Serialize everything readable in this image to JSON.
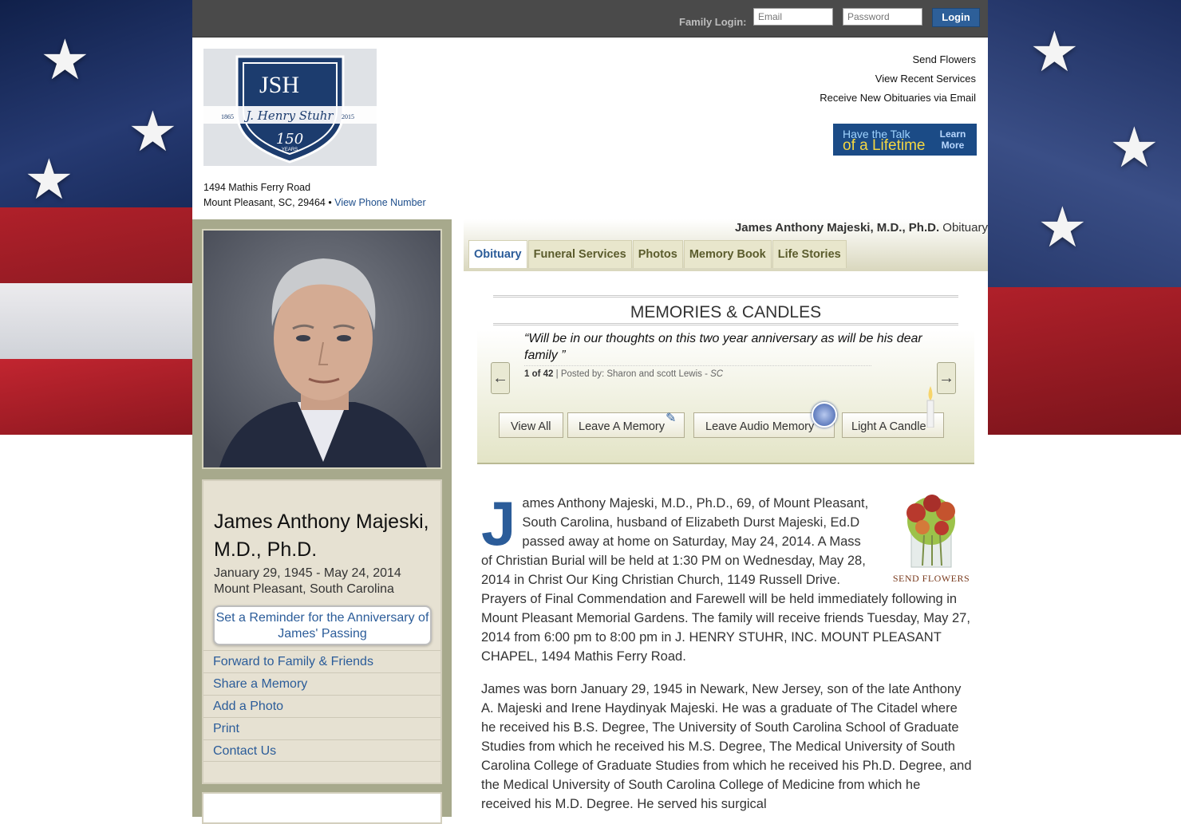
{
  "topbar": {
    "login_label": "Family Login:",
    "email_placeholder": "Email",
    "password_placeholder": "Password",
    "login_button": "Login"
  },
  "header": {
    "address_line1": "1494 Mathis Ferry Road",
    "address_line2": "Mount Pleasant, SC, 29464 •",
    "phone_link": "View Phone Number",
    "links": [
      "Send Flowers",
      "View Recent Services",
      "Receive New Obituaries via Email"
    ],
    "banner": {
      "line1": "Have the Talk",
      "line2": "of a Lifetime",
      "cta": "Learn More"
    }
  },
  "logo": {
    "letters": "JSH",
    "years_left": "1865",
    "years_right": "2015",
    "anniversary": "150",
    "anniversary_sub": "YEARS"
  },
  "deceased": {
    "name": "James Anthony Majeski, M.D., Ph.D.",
    "dates": "January 29, 1945 - May 24, 2014",
    "location": "Mount Pleasant, South Carolina",
    "reminder": "Set a Reminder for the Anniversary of James' Passing"
  },
  "left_links": [
    "Forward to Family & Friends",
    "Share a Memory",
    "Add a Photo",
    "Print",
    "Contact Us"
  ],
  "page_title": {
    "name": "James Anthony Majeski, M.D., Ph.D.",
    "suffix": "Obituary"
  },
  "tabs": [
    "Obituary",
    "Funeral Services",
    "Photos",
    "Memory Book",
    "Life Stories"
  ],
  "memories": {
    "heading": "MEMORIES & CANDLES",
    "quote": "“Will be in our thoughts on this two year anniversary as will be his dear family ”",
    "counter": "1 of 42",
    "posted_by": "| Posted by: Sharon and scott Lewis -",
    "posted_state": "SC",
    "buttons": [
      "View All",
      "Leave A Memory",
      "Leave Audio Memory",
      "Light A Candle"
    ]
  },
  "flowers_label": "SEND FLOWERS",
  "obituary": {
    "dropcap": "J",
    "p1": "ames Anthony Majeski, M.D., Ph.D., 69, of Mount Pleasant, South Carolina, husband of Elizabeth Durst Majeski, Ed.D passed away at home on Saturday, May 24, 2014. A Mass of Christian Burial will be held at 1:30 PM on Wednesday, May 28, 2014 in Christ Our King Christian Church, 1149 Russell Drive. Prayers of Final Commendation and Farewell will be held immediately following in Mount Pleasant Memorial Gardens. The family will receive friends Tuesday, May 27, 2014 from 6:00 pm to 8:00 pm in J. HENRY STUHR, INC. MOUNT PLEASANT CHAPEL, 1494 Mathis Ferry Road.",
    "p2": "James was born January 29, 1945 in Newark, New Jersey, son of the late Anthony A. Majeski and Irene Haydinyak Majeski. He was a graduate of The Citadel where he received his B.S. Degree, The University of South Carolina School of Graduate Studies from which he received his M.S. Degree, The Medical University of South Carolina College of Graduate Studies from which he received his Ph.D. Degree, and the Medical University of South Carolina College of Medicine from which he received his M.D. Degree. He served his surgical"
  }
}
